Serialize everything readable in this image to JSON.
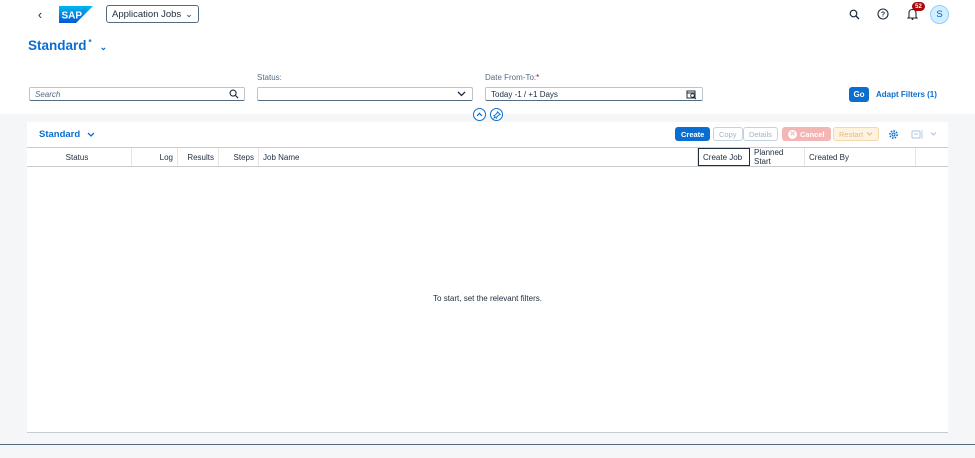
{
  "shell": {
    "logo_text": "SAP",
    "app_title": "Application Jobs",
    "notifications_count": "52",
    "avatar_initial": "S",
    "colors": {
      "brand": "#0a6ed1",
      "badge": "#aa0808"
    }
  },
  "header": {
    "variant": "Standard",
    "variant_modified": "*",
    "search_placeholder": "Search",
    "status_label": "Status:",
    "status_value": "",
    "date_label": "Date From-To:",
    "date_required": "*",
    "date_value": "Today -1 / +1 Days",
    "go_label": "Go",
    "adapt_filters_label": "Adapt Filters (1)"
  },
  "table": {
    "variant": "Standard",
    "buttons": {
      "create": "Create",
      "copy": "Copy",
      "details": "Details",
      "cancel": "Cancel",
      "restart": "Restart"
    },
    "columns": [
      "Status",
      "Log",
      "Results",
      "Steps",
      "Job Name",
      "Create Job",
      "Planned Start",
      "Created By"
    ],
    "empty_text": "To start, set the relevant filters."
  }
}
